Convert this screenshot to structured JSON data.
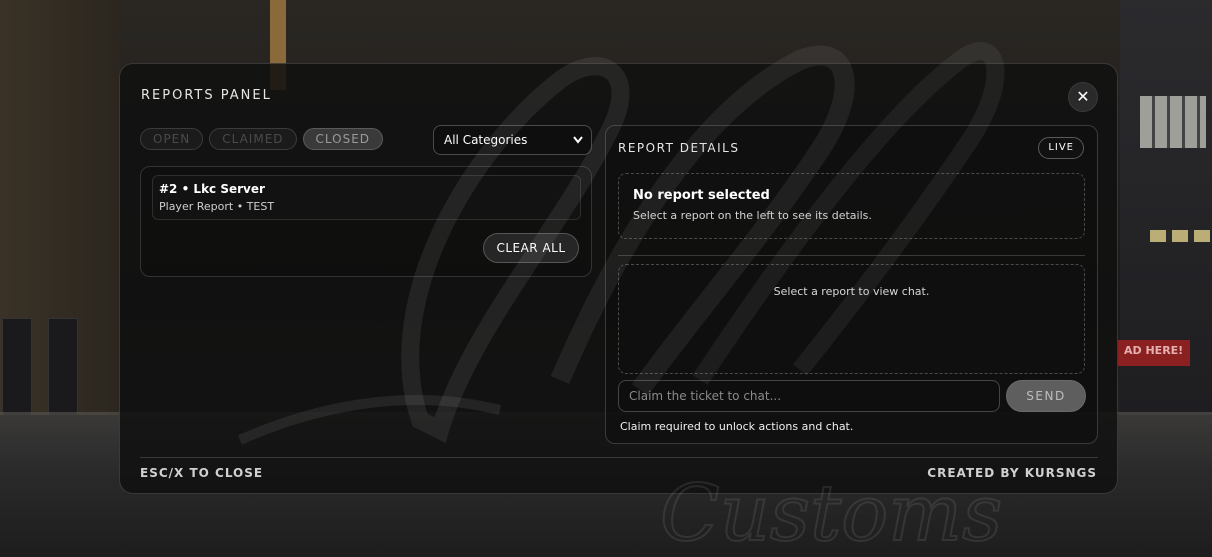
{
  "panel": {
    "title": "REPORTS PANEL",
    "close_label": "✕"
  },
  "tabs": [
    {
      "label": "OPEN",
      "active": false
    },
    {
      "label": "CLAIMED",
      "active": false
    },
    {
      "label": "CLOSED",
      "active": true
    }
  ],
  "category_select": {
    "selected": "All Categories"
  },
  "reports": [
    {
      "title": "#2 • Lkc Server",
      "subtitle": "Player Report • TEST"
    }
  ],
  "clear_all_label": "CLEAR ALL",
  "details": {
    "title": "REPORT DETAILS",
    "live_badge": "LIVE",
    "empty_title": "No report selected",
    "empty_subtitle": "Select a report on the left to see its details.",
    "chat_empty": "Select a report to view chat.",
    "chat_placeholder": "Claim the ticket to chat...",
    "send_label": "SEND",
    "claim_note": "Claim required to unlock actions and chat."
  },
  "footer": {
    "left": "ESC/X TO CLOSE",
    "right": "CREATED BY KURSNGS"
  },
  "background": {
    "sign_text": "AD HERE!",
    "watermark_text": "Customs"
  }
}
